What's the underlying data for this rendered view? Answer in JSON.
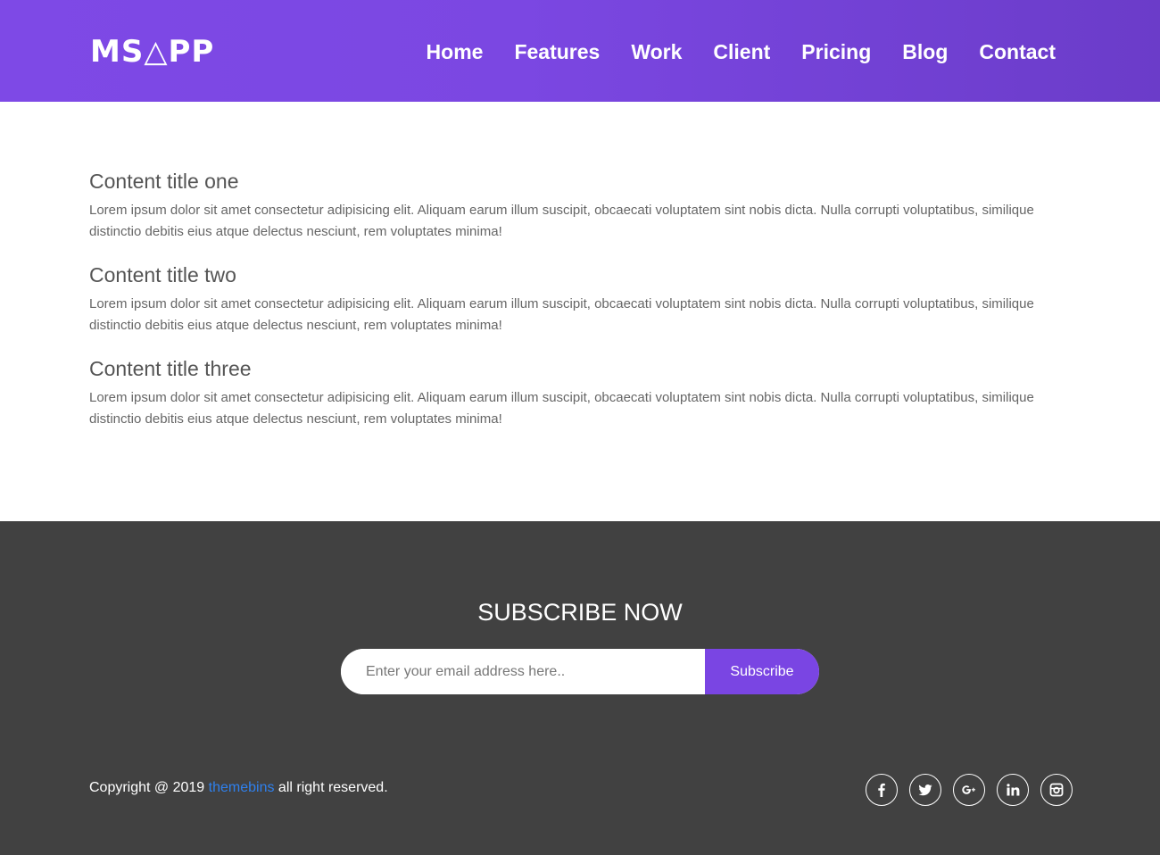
{
  "header": {
    "logo": "MS△PP",
    "nav": [
      "Home",
      "Features",
      "Work",
      "Client",
      "Pricing",
      "Blog",
      "Contact"
    ]
  },
  "content": {
    "sections": [
      {
        "title": "Content title one",
        "text": "Lorem ipsum dolor sit amet consectetur adipisicing elit. Aliquam earum illum suscipit, obcaecati voluptatem sint nobis dicta. Nulla corrupti voluptatibus, similique distinctio debitis eius atque delectus nesciunt, rem voluptates minima!"
      },
      {
        "title": "Content title two",
        "text": "Lorem ipsum dolor sit amet consectetur adipisicing elit. Aliquam earum illum suscipit, obcaecati voluptatem sint nobis dicta. Nulla corrupti voluptatibus, similique distinctio debitis eius atque delectus nesciunt, rem voluptates minima!"
      },
      {
        "title": "Content title three",
        "text": "Lorem ipsum dolor sit amet consectetur adipisicing elit. Aliquam earum illum suscipit, obcaecati voluptatem sint nobis dicta. Nulla corrupti voluptatibus, similique distinctio debitis eius atque delectus nesciunt, rem voluptates minima!"
      }
    ]
  },
  "footer": {
    "subscribe_title": "SUBSCRIBE NOW",
    "email_placeholder": "Enter your email address here..",
    "subscribe_button": "Subscribe",
    "copyright_prefix": "Copyright @ 2019 ",
    "copyright_link": "themebins",
    "copyright_suffix": " all right reserved.",
    "socials": [
      "facebook-icon",
      "twitter-icon",
      "google-plus-icon",
      "linkedin-icon",
      "instagram-icon"
    ]
  },
  "colors": {
    "header_gradient_start": "#7e49e6",
    "header_gradient_end": "#6b3cc9",
    "footer_bg": "#414141",
    "accent": "#7a45e3",
    "link": "#2f80ed"
  }
}
